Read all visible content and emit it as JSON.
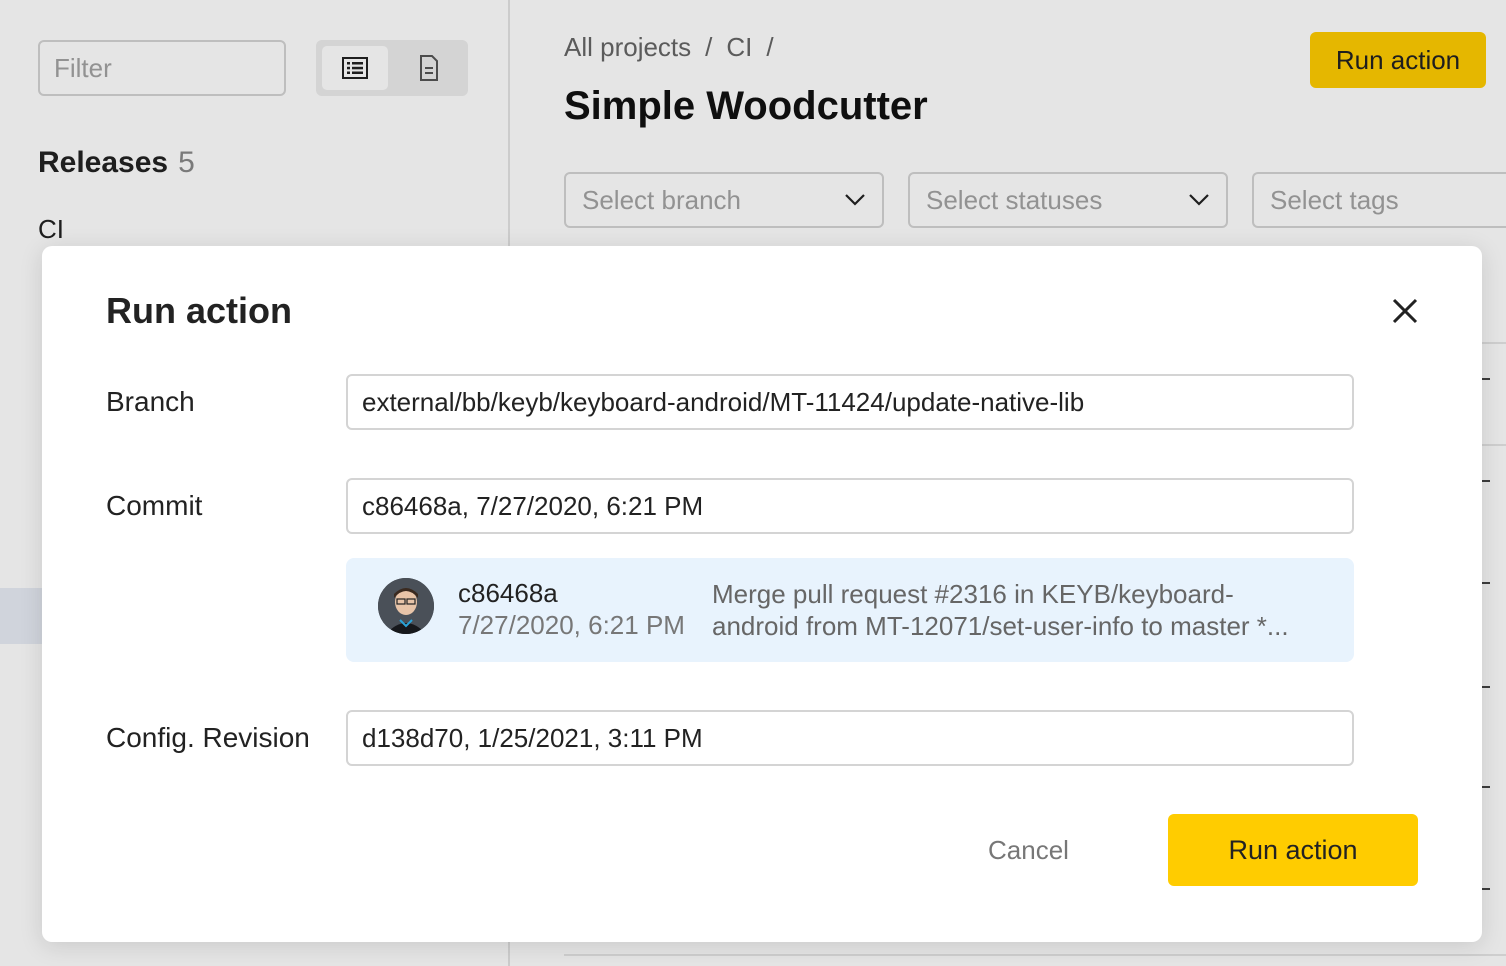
{
  "sidebar": {
    "filter_placeholder": "Filter",
    "releases_title": "Releases",
    "releases_count": "5",
    "items": [
      "CI"
    ]
  },
  "header": {
    "breadcrumb": [
      "All projects",
      "CI"
    ],
    "separator": "/",
    "title": "Simple Woodcutter",
    "run_action_label": "Run action"
  },
  "filters": {
    "branch_placeholder": "Select branch",
    "statuses_placeholder": "Select statuses",
    "tags_placeholder": "Select tags"
  },
  "modal": {
    "title": "Run action",
    "branch_label": "Branch",
    "branch_value": "external/bb/keyb/keyboard-android/MT-11424/update-native-lib",
    "commit_label": "Commit",
    "commit_value": "c86468a, 7/27/2020, 6:21 PM",
    "commit_card": {
      "hash": "c86468a",
      "date": "7/27/2020, 6:21 PM",
      "message": "Merge pull request #2316 in KEYB/keyboard-android from MT-12071/set-user-info to master *..."
    },
    "config_label": "Config. Revision",
    "config_value": "d138d70, 1/25/2021, 3:11 PM",
    "cancel_label": "Cancel",
    "run_label": "Run action"
  },
  "colors": {
    "accent": "#ffcc00",
    "commit_card_bg": "#e8f3fd"
  }
}
